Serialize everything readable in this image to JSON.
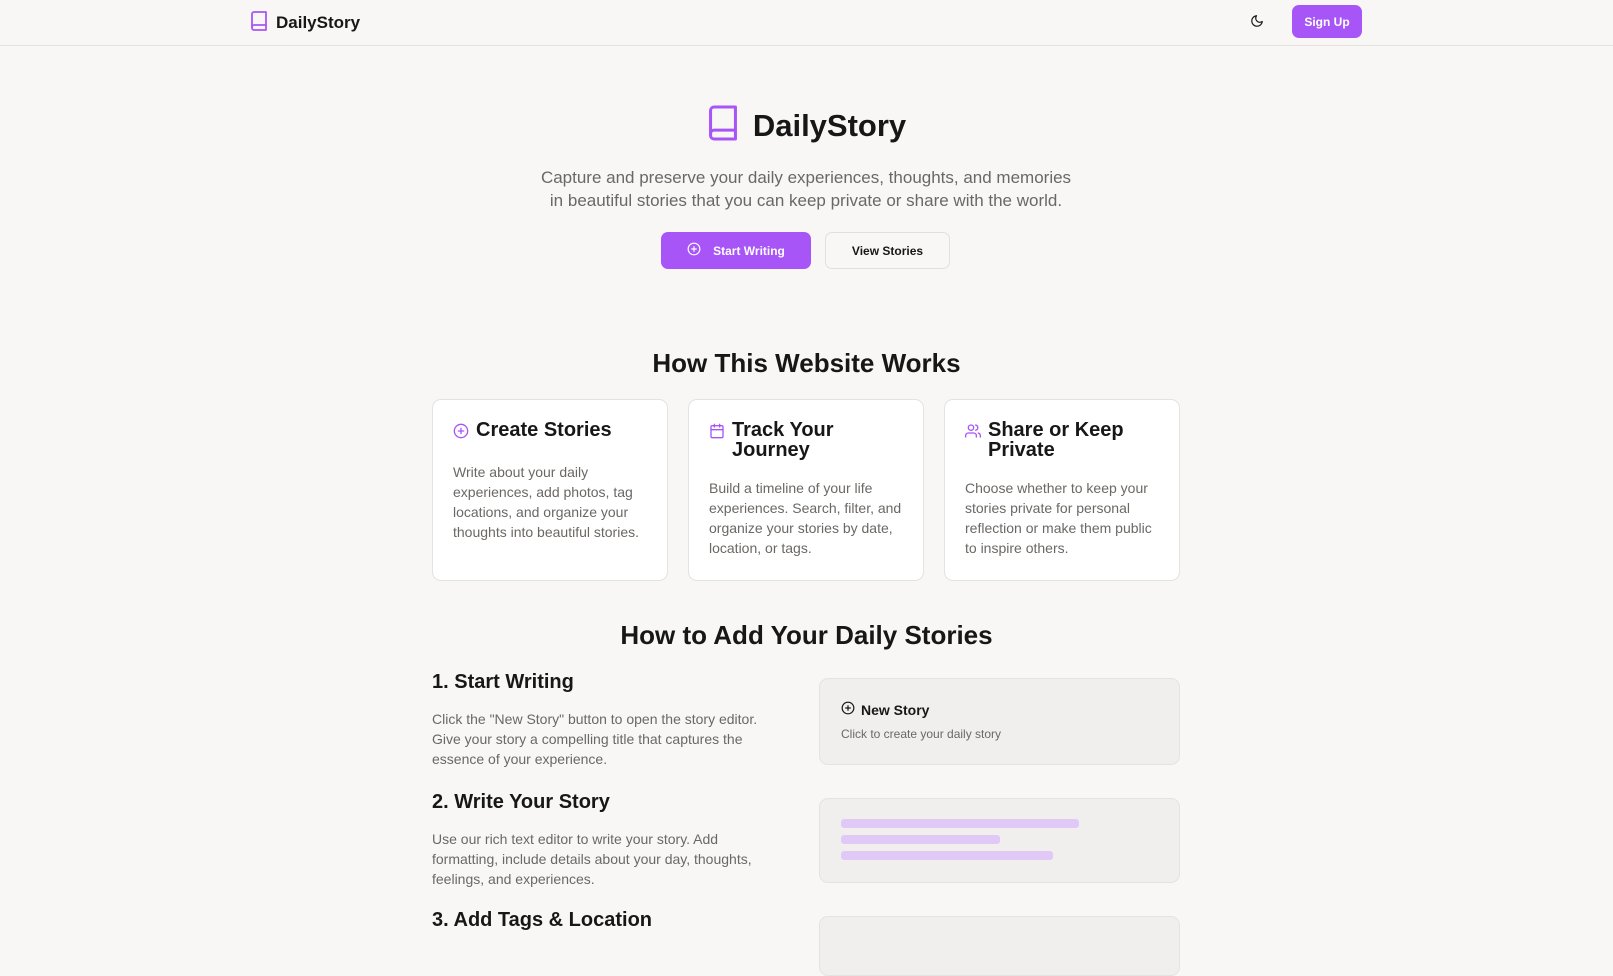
{
  "nav": {
    "brand": "DailyStory",
    "theme_icon": "moon-icon",
    "signup_label": "Sign Up"
  },
  "hero": {
    "title": "DailyStory",
    "subtitle_line1": "Capture and preserve your daily experiences, thoughts, and memories",
    "subtitle_line2": "in beautiful stories that you can keep private or share with the world.",
    "primary_label": "Start Writing",
    "secondary_label": "View Stories"
  },
  "how_it_works": {
    "title": "How This Website Works",
    "cards": [
      {
        "icon": "plus-circle-icon",
        "title": "Create Stories",
        "body": "Write about your daily experiences, add photos, tag locations, and organize your thoughts into beautiful stories."
      },
      {
        "icon": "calendar-icon",
        "title": "Track Your Journey",
        "body": "Build a timeline of your life experiences. Search, filter, and organize your stories by date, location, or tags."
      },
      {
        "icon": "users-icon",
        "title": "Share or Keep Private",
        "body": "Choose whether to keep your stories private for personal reflection or make them public to inspire others."
      }
    ]
  },
  "add_stories": {
    "title": "How to Add Your Daily Stories",
    "steps": [
      {
        "title": "1. Start Writing",
        "body": "Click the \"New Story\" button to open the story editor. Give your story a compelling title that captures the essence of your experience."
      },
      {
        "title": "2. Write Your Story",
        "body": "Use our rich text editor to write your story. Add formatting, include details about your day, thoughts, feelings, and experiences."
      },
      {
        "title": "3. Add Tags & Location"
      }
    ],
    "new_story": {
      "label": "New Story",
      "hint": "Click to create your daily story"
    }
  },
  "colors": {
    "accent": "#a855f7",
    "background": "#f8f7f6",
    "card": "#ffffff",
    "muted_text": "#6b6864",
    "placeholder_bar": "#e0c8f7"
  }
}
